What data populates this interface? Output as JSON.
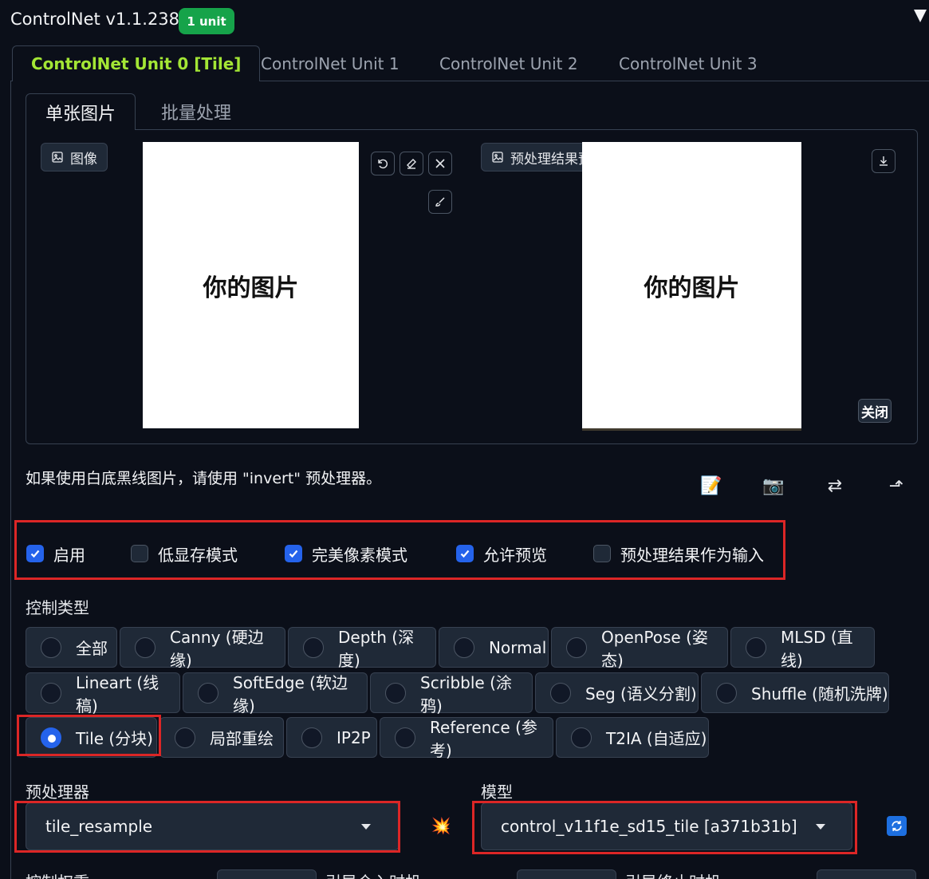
{
  "header": {
    "title": "ControlNet v1.1.238",
    "badge": "1 unit"
  },
  "unit_tabs": [
    {
      "label": "ControlNet Unit 0 [Tile]",
      "active": true
    },
    {
      "label": "ControlNet Unit 1",
      "active": false
    },
    {
      "label": "ControlNet Unit 2",
      "active": false
    },
    {
      "label": "ControlNet Unit 3",
      "active": false
    }
  ],
  "image_tabs": [
    {
      "label": "单张图片",
      "active": true
    },
    {
      "label": "批量处理",
      "active": false
    }
  ],
  "input_image": {
    "label": "图像",
    "placeholder_text": "你的图片"
  },
  "preview_image": {
    "label": "预处理结果预览",
    "placeholder_text": "你的图片",
    "close_label": "关闭"
  },
  "hint": "如果使用白底黑线图片，请使用 \"invert\" 预处理器。",
  "tool_icons": [
    "📝",
    "📷",
    "⇄",
    "⬏"
  ],
  "checkboxes": [
    {
      "label": "启用",
      "checked": true
    },
    {
      "label": "低显存模式",
      "checked": false
    },
    {
      "label": "完美像素模式",
      "checked": true
    },
    {
      "label": "允许预览",
      "checked": true
    },
    {
      "label": "预处理结果作为输入",
      "checked": false
    }
  ],
  "control_type": {
    "label": "控制类型",
    "options": [
      {
        "label": "全部",
        "selected": false
      },
      {
        "label": "Canny (硬边缘)",
        "selected": false
      },
      {
        "label": "Depth (深度)",
        "selected": false
      },
      {
        "label": "Normal",
        "selected": false
      },
      {
        "label": "OpenPose (姿态)",
        "selected": false
      },
      {
        "label": "MLSD (直线)",
        "selected": false
      },
      {
        "label": "Lineart (线稿)",
        "selected": false
      },
      {
        "label": "SoftEdge (软边缘)",
        "selected": false
      },
      {
        "label": "Scribble (涂鸦)",
        "selected": false
      },
      {
        "label": "Seg (语义分割)",
        "selected": false
      },
      {
        "label": "Shuffle (随机洗牌)",
        "selected": false
      },
      {
        "label": "Tile (分块)",
        "selected": true
      },
      {
        "label": "局部重绘",
        "selected": false
      },
      {
        "label": "IP2P",
        "selected": false
      },
      {
        "label": "Reference (参考)",
        "selected": false
      },
      {
        "label": "T2IA (自适应)",
        "selected": false
      }
    ]
  },
  "preprocessor": {
    "label": "预处理器",
    "value": "tile_resample"
  },
  "model": {
    "label": "模型",
    "value": "control_v11f1e_sd15_tile [a371b31b]"
  },
  "run_preprocessor_icon": "💥",
  "bottom_labels": [
    "控制权重",
    "引导介入时机",
    "引导终止时机"
  ],
  "colors": {
    "background": "#0b0f19",
    "accent_tab": "#a3e635",
    "badge": "#16a34a",
    "checkbox": "#2563eb",
    "highlight": "#dc2626"
  }
}
